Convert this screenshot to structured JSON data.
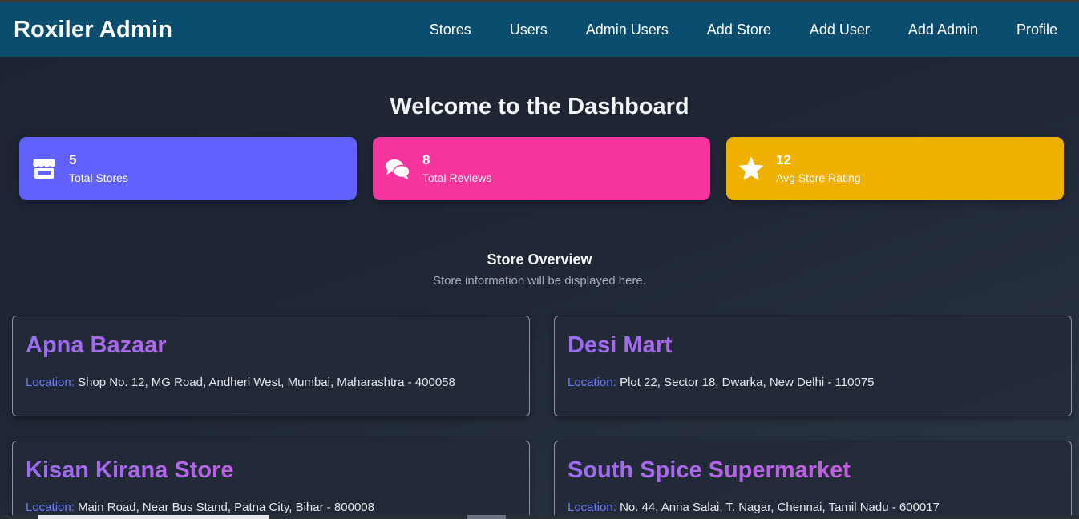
{
  "navbar": {
    "brand": "Roxiler Admin",
    "links": [
      "Stores",
      "Users",
      "Admin Users",
      "Add Store",
      "Add User",
      "Add Admin",
      "Profile"
    ]
  },
  "dashboard": {
    "title": "Welcome to the Dashboard",
    "stats": [
      {
        "value": "5",
        "label": "Total Stores",
        "icon": "store-icon",
        "color": "#6161ff"
      },
      {
        "value": "8",
        "label": "Total Reviews",
        "icon": "comments-icon",
        "color": "#f5359d"
      },
      {
        "value": "12",
        "label": "Avg Store Rating",
        "icon": "star-icon",
        "color": "#efb000"
      }
    ]
  },
  "overview": {
    "heading": "Store Overview",
    "subtitle": "Store information will be displayed here."
  },
  "stores": [
    {
      "name": "Apna Bazaar",
      "location_label": "Location:",
      "location": "Shop No. 12, MG Road, Andheri West, Mumbai, Maharashtra - 400058"
    },
    {
      "name": "Desi Mart",
      "location_label": "Location:",
      "location": "Plot 22, Sector 18, Dwarka, New Delhi - 110075"
    },
    {
      "name": "Kisan Kirana Store",
      "location_label": "Location:",
      "location": "Main Road, Near Bus Stand, Patna City, Bihar - 800008"
    },
    {
      "name": "South Spice Supermarket",
      "location_label": "Location:",
      "location": "No. 44, Anna Salai, T. Nagar, Chennai, Tamil Nadu - 600017"
    }
  ]
}
